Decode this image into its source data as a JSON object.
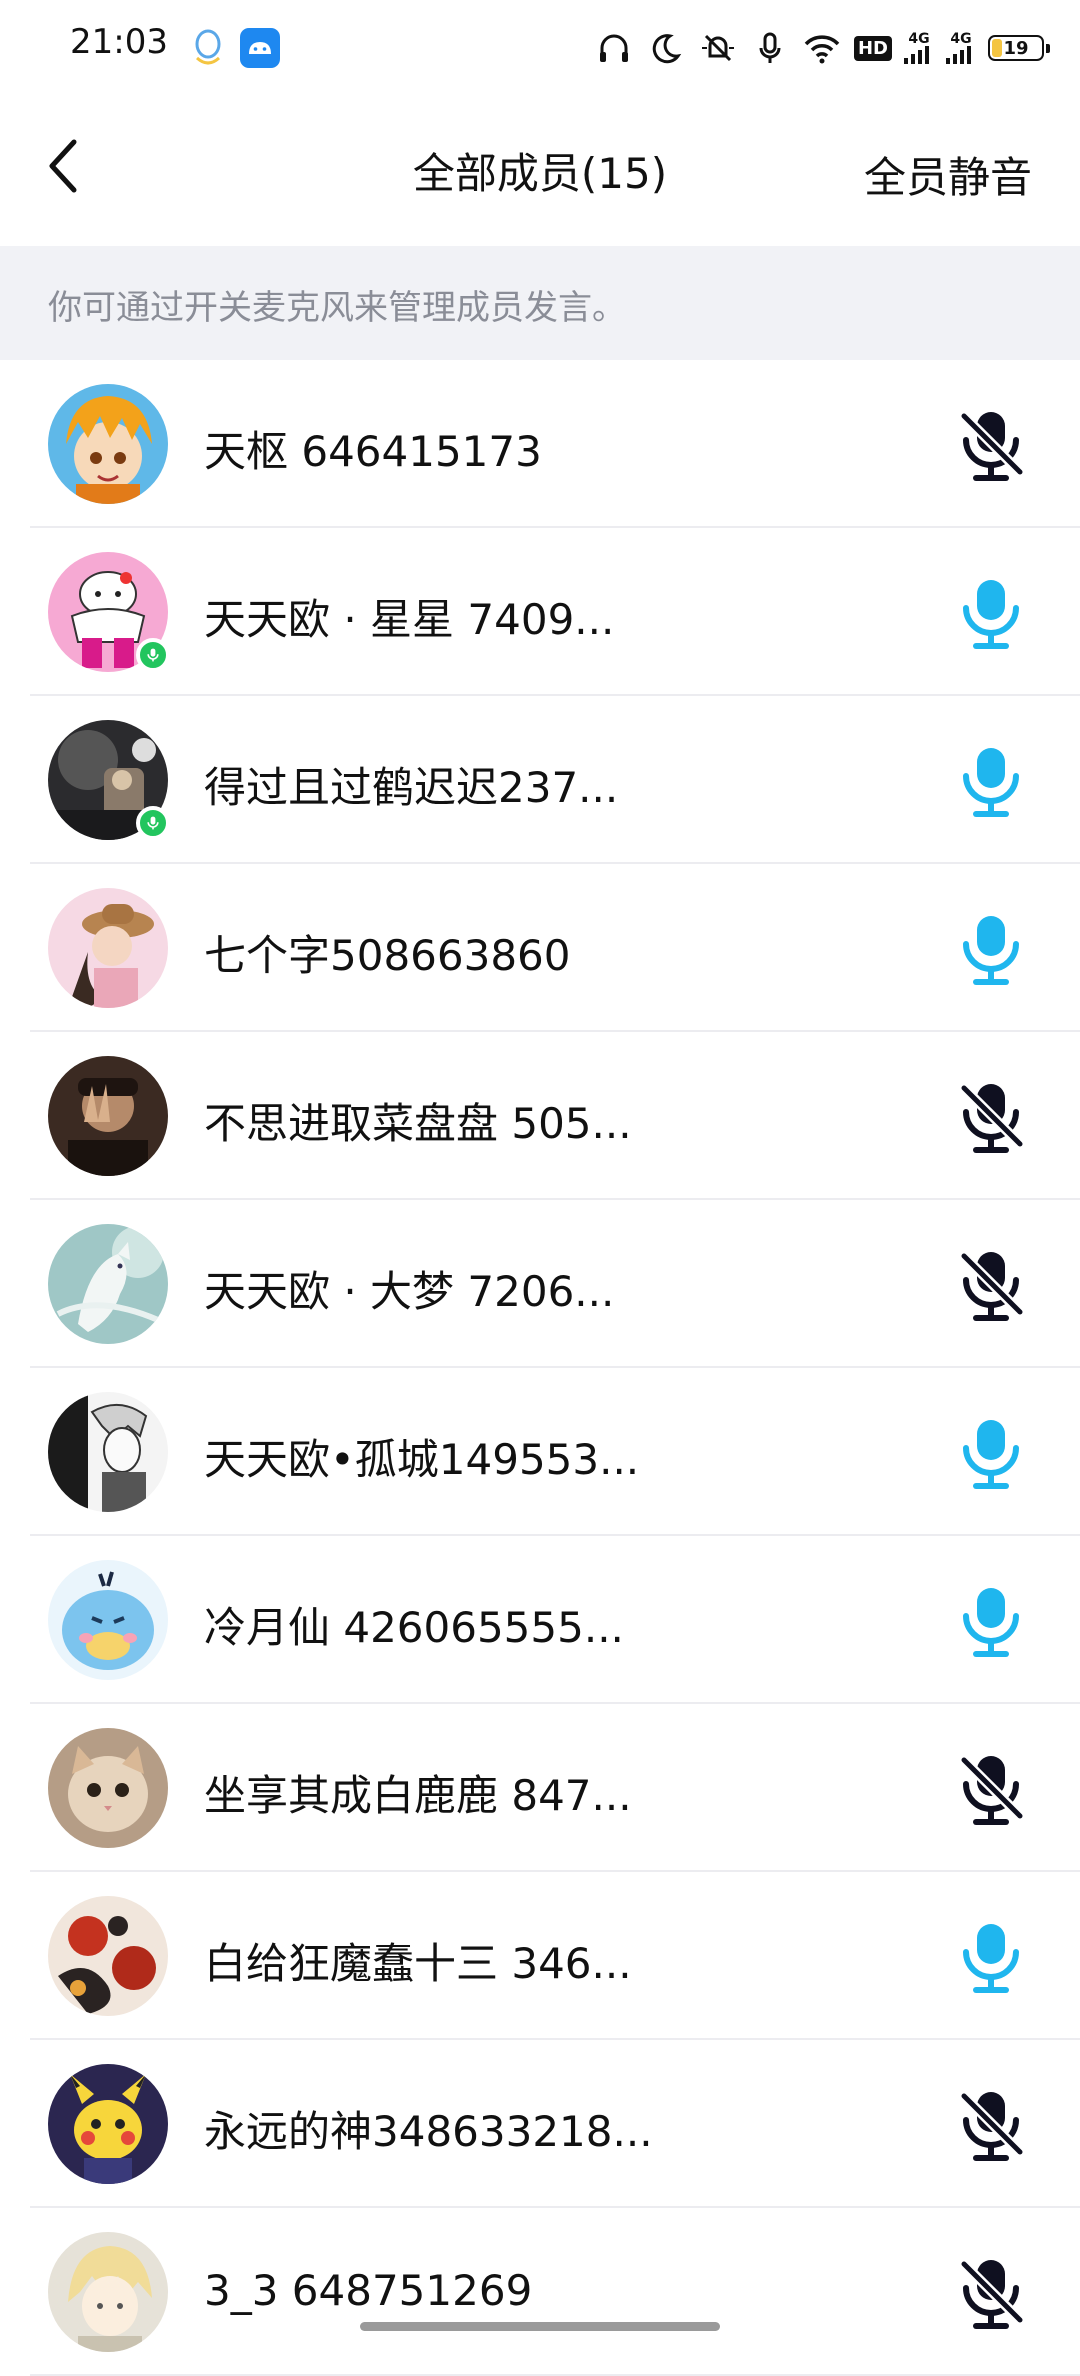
{
  "status_bar": {
    "time": "21:03",
    "hd_label": "HD",
    "network_1": "4G",
    "network_2": "4G",
    "battery_level": "19"
  },
  "header": {
    "title": "全部成员(15)",
    "mute_all_label": "全员静音"
  },
  "hint": "你可通过开关麦克风来管理成员发言。",
  "colors": {
    "mic_on": "#1fb6ee",
    "mic_off": "#0f1020",
    "speaking_badge": "#22c55e",
    "hint_bg": "#f1f2f6"
  },
  "members": [
    {
      "name": "天枢 646415173",
      "mic": "off",
      "speaking": false,
      "avatar": "orange-haired-anime-avatar"
    },
    {
      "name": "天天欧 · 星星  7409...",
      "mic": "on",
      "speaking": true,
      "avatar": "pink-muscle-cat-avatar"
    },
    {
      "name": "得过且过鹤迟迟237...",
      "mic": "on",
      "speaking": true,
      "avatar": "dark-photo-avatar"
    },
    {
      "name": "七个字508663860",
      "mic": "on",
      "speaking": false,
      "avatar": "girl-hat-avatar"
    },
    {
      "name": "不思进取菜盘盘 505...",
      "mic": "off",
      "speaking": false,
      "avatar": "hand-gesture-photo-avatar"
    },
    {
      "name": "天天欧 · 大梦 7206...",
      "mic": "off",
      "speaking": false,
      "avatar": "white-fox-art-avatar"
    },
    {
      "name": "天天欧•孤城149553...",
      "mic": "on",
      "speaking": false,
      "avatar": "manga-sketch-avatar"
    },
    {
      "name": "冷月仙  426065555...",
      "mic": "on",
      "speaking": false,
      "avatar": "blue-bird-cartoon-avatar"
    },
    {
      "name": "坐享其成白鹿鹿 847...",
      "mic": "off",
      "speaking": false,
      "avatar": "kitten-photo-avatar"
    },
    {
      "name": "白给狂魔蠢十三 346...",
      "mic": "on",
      "speaking": false,
      "avatar": "red-white-art-avatar"
    },
    {
      "name": "永远的神348633218...",
      "mic": "off",
      "speaking": false,
      "avatar": "pikachu-avatar"
    },
    {
      "name": "3_3  648751269",
      "mic": "off",
      "speaking": false,
      "avatar": "blonde-anime-avatar"
    }
  ]
}
